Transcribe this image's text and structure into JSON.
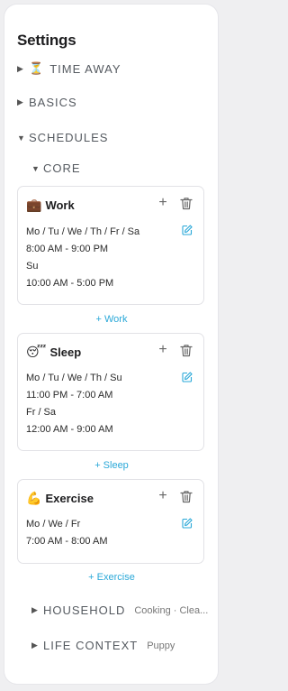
{
  "settings": {
    "title": "Settings"
  },
  "sections": {
    "time_away": {
      "label": "TIME AWAY",
      "emoji": "⏳",
      "caret": "▶"
    },
    "basics": {
      "label": "BASICS",
      "caret": "▶"
    },
    "schedules": {
      "label": "SCHEDULES",
      "caret": "▼"
    },
    "core": {
      "label": "CORE",
      "caret": "▼"
    },
    "household": {
      "label": "HOUSEHOLD",
      "caret": "▶",
      "summary": "Cooking · Clea..."
    },
    "life_context": {
      "label": "LIFE CONTEXT",
      "caret": "▶",
      "summary": "Puppy"
    }
  },
  "cards": {
    "work": {
      "emoji": "💼",
      "name": "Work",
      "lines": [
        "Mo / Tu / We / Th / Fr / Sa",
        "8:00 AM - 9:00 PM",
        "Su",
        "10:00 AM - 5:00 PM"
      ],
      "add_label": "+ Work"
    },
    "sleep": {
      "emoji": "😴",
      "name": "Sleep",
      "lines": [
        "Mo / Tu / We / Th / Su",
        "11:00 PM - 7:00 AM",
        "Fr / Sa",
        "12:00 AM - 9:00 AM"
      ],
      "add_label": "+ Sleep"
    },
    "exercise": {
      "emoji": "💪",
      "name": "Exercise",
      "lines": [
        "Mo / We / Fr",
        "7:00 AM - 8:00 AM"
      ],
      "add_label": "+ Exercise"
    }
  },
  "icons": {
    "plus": "+",
    "trash": "trash-icon",
    "edit": "edit-icon",
    "accent": "#2aa8d8"
  }
}
